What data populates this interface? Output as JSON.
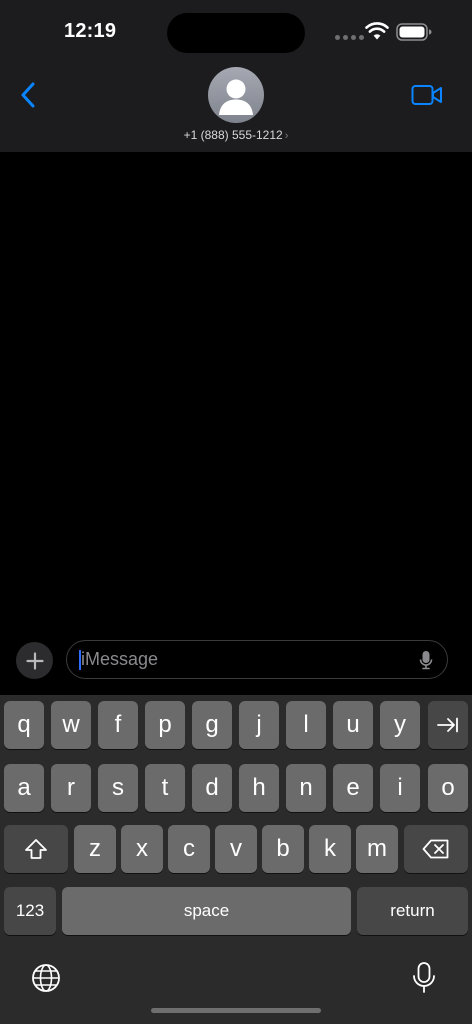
{
  "status_bar": {
    "time": "12:19",
    "icons": [
      "cellular-dots-icon",
      "wifi-icon",
      "battery-icon"
    ]
  },
  "nav": {
    "back_icon": "chevron-left-icon",
    "avatar_icon": "person-silhouette-icon",
    "contact": "+1 (888) 555-1212",
    "contact_chevron": "›",
    "video_icon": "video-camera-icon"
  },
  "compose": {
    "plus_icon": "plus-icon",
    "placeholder": "iMessage",
    "value": "",
    "mic_icon": "microphone-icon"
  },
  "keyboard": {
    "row1": [
      "q",
      "w",
      "f",
      "p",
      "g",
      "j",
      "l",
      "u",
      "y"
    ],
    "row1_extra_icon": "tab-arrow-icon",
    "row2": [
      "a",
      "r",
      "s",
      "t",
      "d",
      "h",
      "n",
      "e",
      "i",
      "o"
    ],
    "row3": [
      "z",
      "x",
      "c",
      "v",
      "b",
      "k",
      "m"
    ],
    "shift_icon": "shift-icon",
    "delete_icon": "delete-icon",
    "numbers_label": "123",
    "space_label": "space",
    "return_label": "return",
    "globe_icon": "globe-icon",
    "dictation_icon": "microphone-icon"
  },
  "colors": {
    "accent": "#0a84ff",
    "header_bg": "#1c1c1e",
    "keyboard_bg": "#2b2b2b",
    "key_light": "#6b6b6b",
    "key_dark": "#474747",
    "caret": "#2f6bff"
  }
}
